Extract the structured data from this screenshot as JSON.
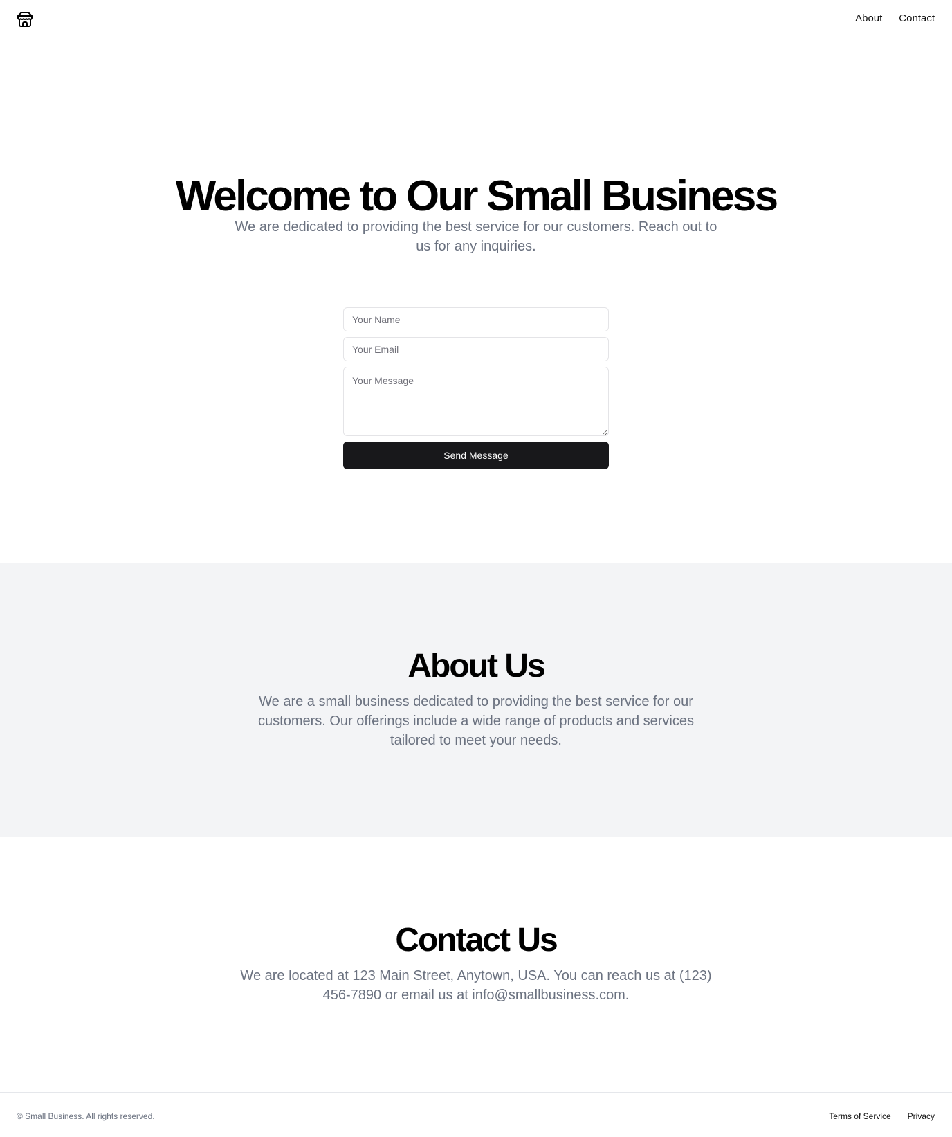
{
  "header": {
    "logo_icon": "store-icon",
    "nav": [
      {
        "label": "About"
      },
      {
        "label": "Contact"
      }
    ]
  },
  "hero": {
    "title": "Welcome to Our Small Business",
    "subtitle": "We are dedicated to providing the best service for our customers. Reach out to us for any inquiries.",
    "form": {
      "name_placeholder": "Your Name",
      "email_placeholder": "Your Email",
      "message_placeholder": "Your Message",
      "submit_label": "Send Message"
    }
  },
  "about": {
    "title": "About Us",
    "text": "We are a small business dedicated to providing the best service for our customers. Our offerings include a wide range of products and services tailored to meet your needs."
  },
  "contact": {
    "title": "Contact Us",
    "text": "We are located at 123 Main Street, Anytown, USA. You can reach us at (123) 456-7890 or email us at info@smallbusiness.com."
  },
  "footer": {
    "copyright": "© Small Business. All rights reserved.",
    "links": [
      {
        "label": "Terms of Service"
      },
      {
        "label": "Privacy"
      }
    ]
  },
  "colors": {
    "background": "#ffffff",
    "section_alt": "#f3f4f6",
    "muted_text": "#6b7280",
    "button": "#18181b"
  }
}
